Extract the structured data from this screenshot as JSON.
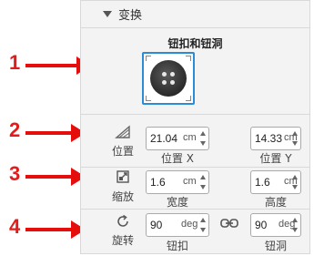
{
  "annotations": [
    "1",
    "2",
    "3",
    "4"
  ],
  "panel": {
    "header_title": "变换",
    "button_section_title": "钮扣和钮洞",
    "rows": [
      {
        "label": "位置",
        "icon": "position-triangle-icon",
        "left": {
          "value": "21.04",
          "unit": "cm",
          "caption": "位置 X"
        },
        "right": {
          "value": "14.33",
          "unit": "cm",
          "caption": "位置 Y"
        }
      },
      {
        "label": "缩放",
        "icon": "scale-icon",
        "left": {
          "value": "1.6",
          "unit": "cm",
          "caption": "宽度"
        },
        "right": {
          "value": "1.6",
          "unit": "cm",
          "caption": "高度"
        }
      },
      {
        "label": "旋转",
        "icon": "rotate-icon",
        "left": {
          "value": "90",
          "unit": "deg",
          "caption": "钮扣"
        },
        "right": {
          "value": "90",
          "unit": "deg",
          "caption": "钮洞"
        }
      }
    ],
    "link_icon": "link-icon"
  },
  "colors": {
    "accent": "#2a8bd8",
    "annotation": "#e01d1d"
  }
}
